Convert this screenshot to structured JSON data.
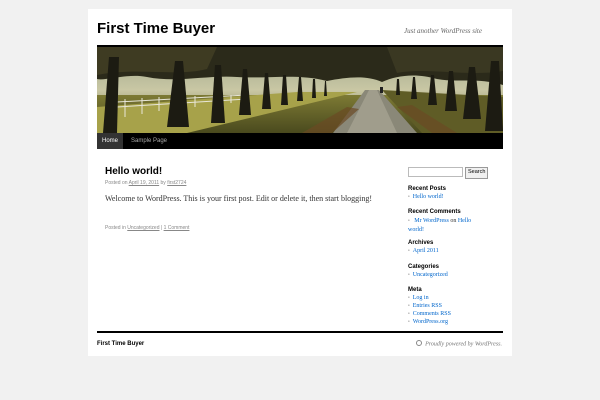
{
  "site": {
    "title": "First Time Buyer",
    "description": "Just another WordPress site"
  },
  "nav": {
    "items": [
      {
        "label": "Home",
        "active": true
      },
      {
        "label": "Sample Page",
        "active": false
      }
    ]
  },
  "post": {
    "title": "Hello world!",
    "meta_posted_on": "Posted on",
    "meta_date": "April 19, 2011",
    "meta_by": "by",
    "meta_author": "first2724",
    "body": "Welcome to WordPress. This is your first post. Edit or delete it, then start blogging!",
    "footer_posted_in": "Posted in",
    "footer_category": "Uncategorized",
    "footer_sep": "|",
    "footer_comments": "1 Comment"
  },
  "sidebar": {
    "search_placeholder": "",
    "search_button": "Search",
    "recent_posts": {
      "heading": "Recent Posts",
      "items": [
        "Hello world!"
      ]
    },
    "recent_comments": {
      "heading": "Recent Comments",
      "author": "Mr WordPress",
      "on": "on",
      "post": "Hello world!"
    },
    "archives": {
      "heading": "Archives",
      "items": [
        "April 2011"
      ]
    },
    "categories": {
      "heading": "Categories",
      "items": [
        "Uncategorized"
      ]
    },
    "meta": {
      "heading": "Meta",
      "items": [
        "Log in",
        "Entries RSS",
        "Comments RSS",
        "WordPress.org"
      ]
    }
  },
  "footer": {
    "site_title": "First Time Buyer",
    "credit": "Proudly powered by WordPress."
  },
  "icons": {
    "footer_logo": "wordpress-icon"
  }
}
